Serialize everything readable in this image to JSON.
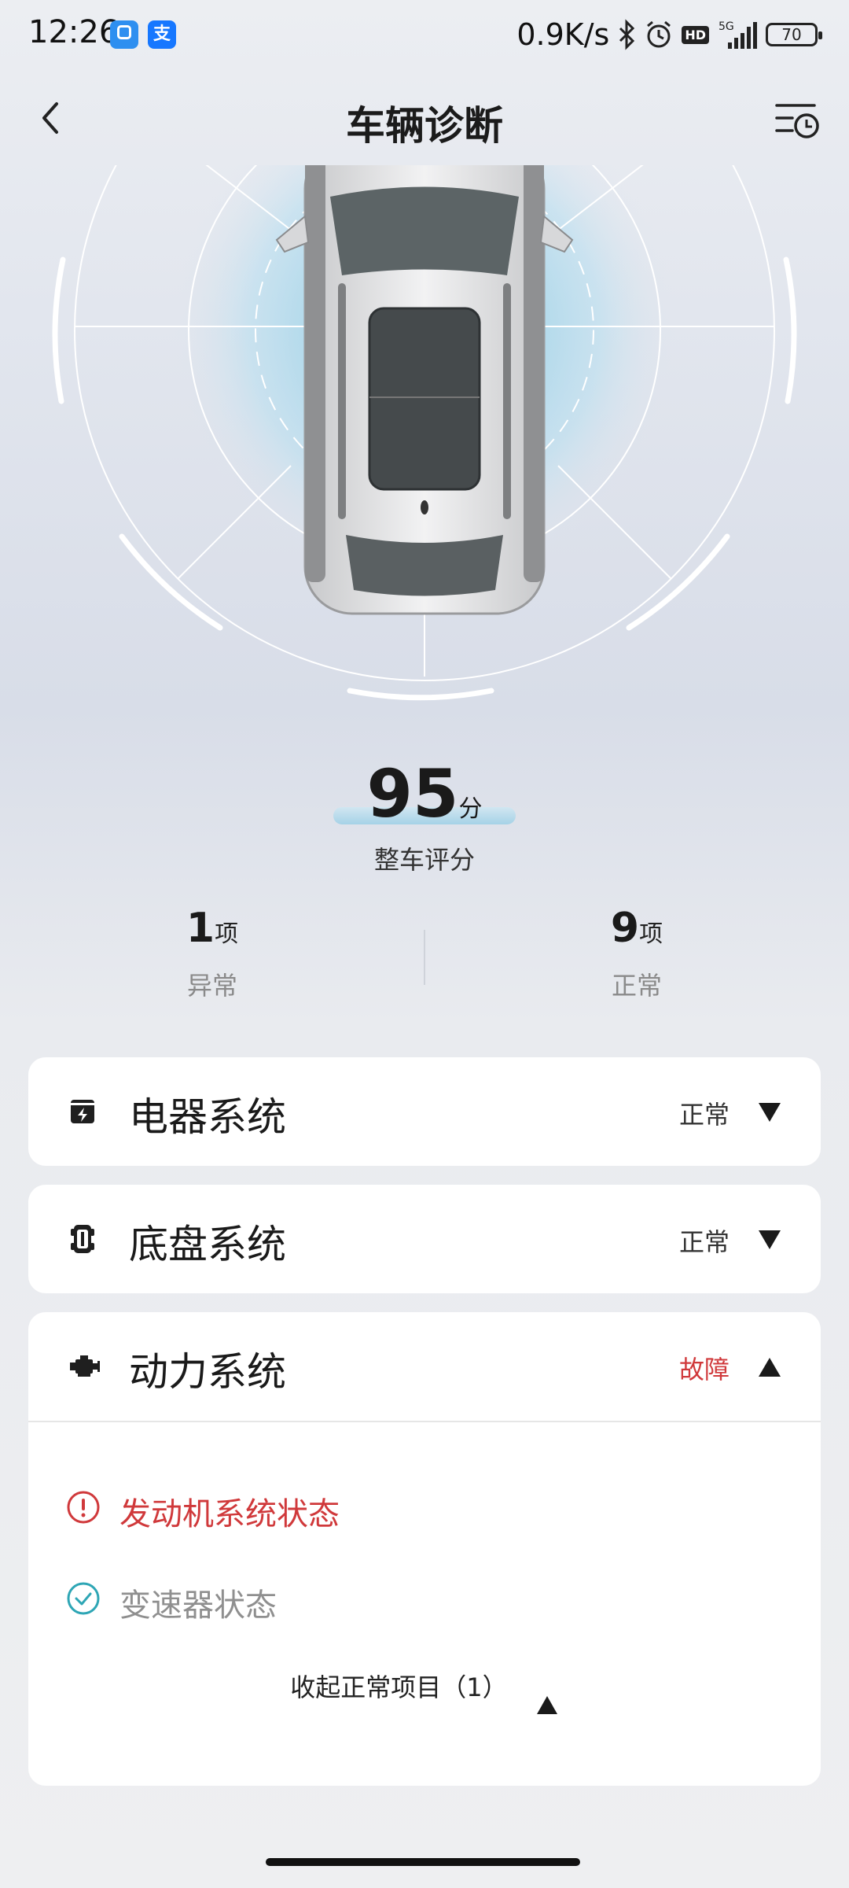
{
  "status_bar": {
    "time": "12:26",
    "net_speed": "0.9K/s",
    "signal": "5G",
    "battery": "70"
  },
  "header": {
    "title": "车辆诊断"
  },
  "score": {
    "value": "95",
    "unit": "分",
    "label": "整车评分"
  },
  "stats": {
    "abnormal": {
      "count": "1",
      "unit": "项",
      "label": "异常"
    },
    "normal": {
      "count": "9",
      "unit": "项",
      "label": "正常"
    }
  },
  "systems": [
    {
      "name": "电器系统",
      "status": "正常",
      "icon": "electrical-icon",
      "expanded": false
    },
    {
      "name": "底盘系统",
      "status": "正常",
      "icon": "chassis-icon",
      "expanded": false
    },
    {
      "name": "动力系统",
      "status": "故障",
      "icon": "engine-icon",
      "expanded": true
    }
  ],
  "power_items": [
    {
      "text": "发动机系统状态",
      "state": "error",
      "icon": "alert-circle-icon"
    },
    {
      "text": "变速器状态",
      "state": "ok",
      "icon": "check-circle-icon"
    }
  ],
  "collapse": {
    "label": "收起正常项目（1）"
  },
  "colors": {
    "fault": "#d0393b",
    "ok_teal": "#2ea6b5",
    "glow": "#9fd3e8"
  }
}
